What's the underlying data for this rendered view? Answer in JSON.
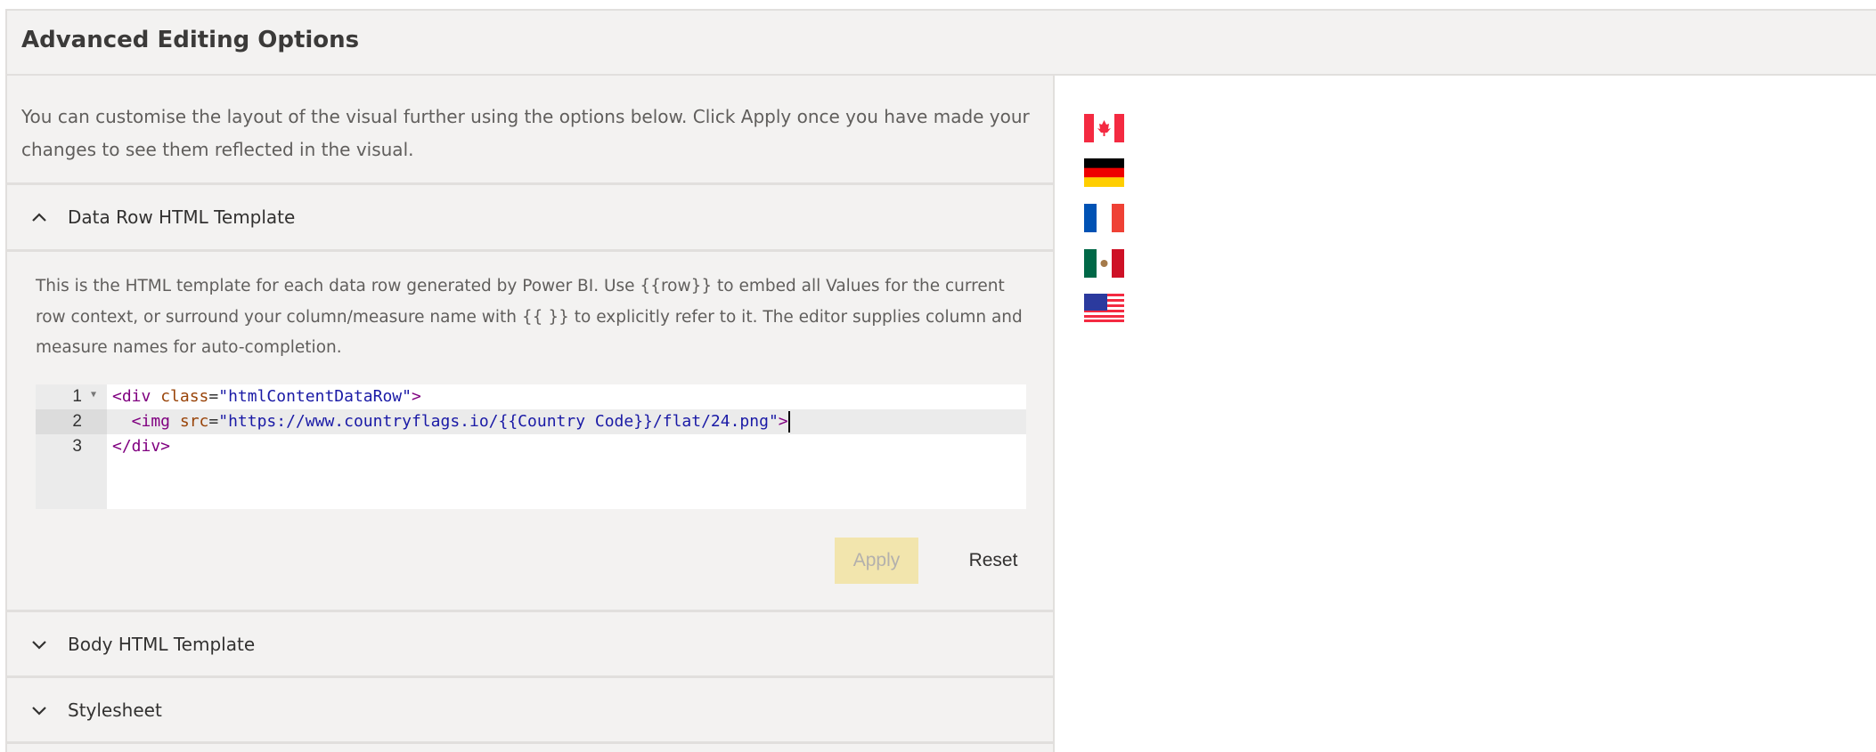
{
  "header": {
    "title": "Advanced Editing Options"
  },
  "intro": "You can customise the layout of the visual further using the options below. Click Apply once you have made your changes to see them reflected in the visual.",
  "sections": [
    {
      "label": "Data Row HTML Template",
      "expanded": true,
      "description": "This is the HTML template for each data row generated by Power BI. Use {{row}} to embed all Values for the current row context, or surround your column/measure name with {{ }} to explicitly refer to it. The editor supplies column and measure names for auto-completion.",
      "editor": {
        "line_numbers": [
          "1",
          "2",
          "3"
        ],
        "lines": [
          {
            "t1": "<div",
            "a1": " class",
            "eq": "=",
            "s1": "\"htmlContentDataRow\"",
            "t2": ">"
          },
          {
            "t1": "  <img",
            "a1": " src",
            "eq": "=",
            "s1": "\"https://www.countryflags.io/{{Country Code}}/flat/24.png\"",
            "t2": ">"
          },
          {
            "t1": "</div>"
          }
        ]
      },
      "apply_label": "Apply",
      "reset_label": "Reset"
    },
    {
      "label": "Body HTML Template",
      "expanded": false
    },
    {
      "label": "Stylesheet",
      "expanded": false
    }
  ],
  "preview": {
    "flags": [
      "canada-flag",
      "germany-flag",
      "france-flag",
      "mexico-flag",
      "usa-flag"
    ]
  },
  "colors": {
    "apply_bg": "#f2e5ad",
    "panel_bg": "#f3f2f1",
    "tag": "#800080",
    "attr": "#994409",
    "string": "#1a1aa6"
  }
}
